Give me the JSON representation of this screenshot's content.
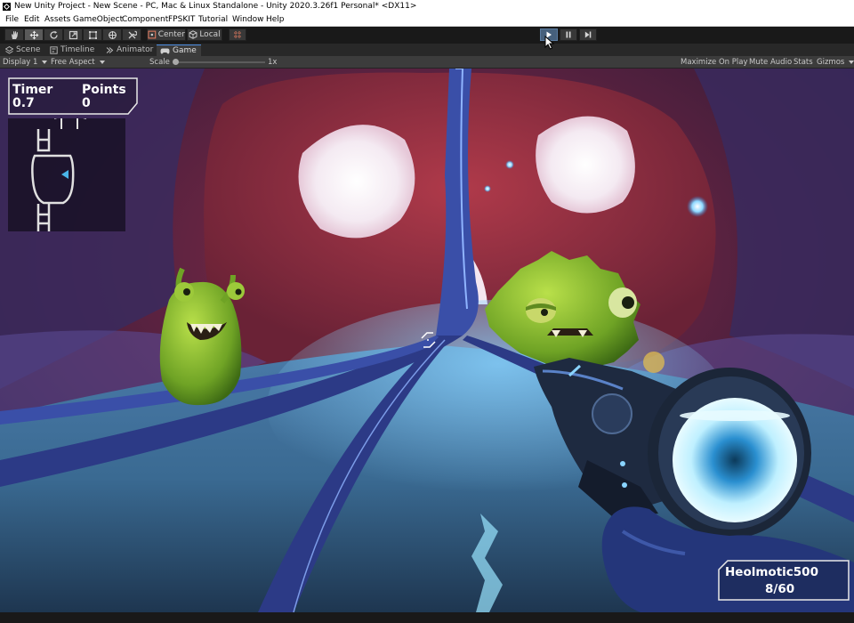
{
  "window": {
    "title": "New Unity Project - New Scene - PC, Mac & Linux Standalone - Unity 2020.3.26f1 Personal* <DX11>"
  },
  "menu": {
    "items": [
      "File",
      "Edit",
      "Assets",
      "GameObject",
      "Component",
      "FPSKIT",
      "Tutorial",
      "Window",
      "Help"
    ]
  },
  "toolbar": {
    "tools": [
      "hand",
      "move",
      "rotate",
      "scale",
      "rect",
      "transform",
      "custom"
    ],
    "pivot_label": "Center",
    "space_label": "Local",
    "play_state": "playing"
  },
  "tabs": [
    {
      "label": "Scene",
      "icon": "scene-icon",
      "active": false
    },
    {
      "label": "Timeline",
      "icon": "timeline-icon",
      "active": false
    },
    {
      "label": "Animator",
      "icon": "animator-icon",
      "active": false
    },
    {
      "label": "Game",
      "icon": "game-icon",
      "active": true
    }
  ],
  "game_toolbar": {
    "display": "Display 1",
    "aspect": "Free Aspect",
    "scale_label": "Scale",
    "scale_value": "1x",
    "maximize_on_play": "Maximize On Play",
    "mute_audio": "Mute Audio",
    "stats": "Stats",
    "gizmos": "Gizmos"
  },
  "hud": {
    "timer_label": "Timer",
    "timer_value": "0.7",
    "points_label": "Points",
    "points_value": "0",
    "weapon_name": "Heolmotic500",
    "ammo": "8/60"
  },
  "colors": {
    "play_active": "#46607c",
    "accent_tab": "#4a8be0",
    "hud_text": "#ffffff"
  }
}
